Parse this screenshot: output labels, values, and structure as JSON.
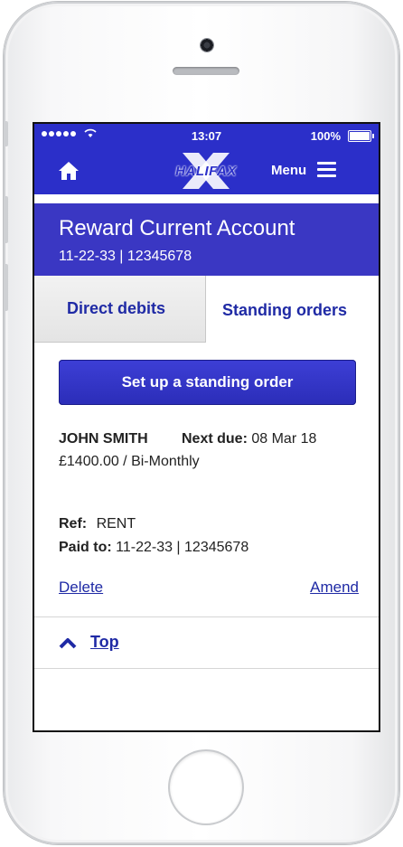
{
  "status_bar": {
    "time": "13:07",
    "battery": "100%"
  },
  "header": {
    "menu_label": "Menu",
    "logo_text": "HALIFAX"
  },
  "account": {
    "name": "Reward Current Account",
    "number": "11-22-33 | 12345678"
  },
  "tabs": [
    {
      "label": "Direct debits",
      "active": false
    },
    {
      "label": "Standing orders",
      "active": true
    }
  ],
  "setup_button_label": "Set up a standing order",
  "order": {
    "payee": "JOHN SMITH",
    "next_due_label": "Next due:",
    "next_due_value": "08 Mar 18",
    "amount_frequency": "£1400.00 / Bi-Monthly",
    "ref_label": "Ref:",
    "ref_value": "RENT",
    "paid_to_label": "Paid to:",
    "paid_to_value": "11-22-33 | 12345678"
  },
  "actions": {
    "delete": "Delete",
    "amend": "Amend"
  },
  "top_link": "Top",
  "colors": {
    "brand_blue": "#2b2fc9",
    "account_band": "#3a37c3",
    "link": "#1f2aa5"
  },
  "icons": [
    "home-icon",
    "menu-icon",
    "wifi-icon",
    "battery-icon",
    "chevron-up-icon"
  ]
}
